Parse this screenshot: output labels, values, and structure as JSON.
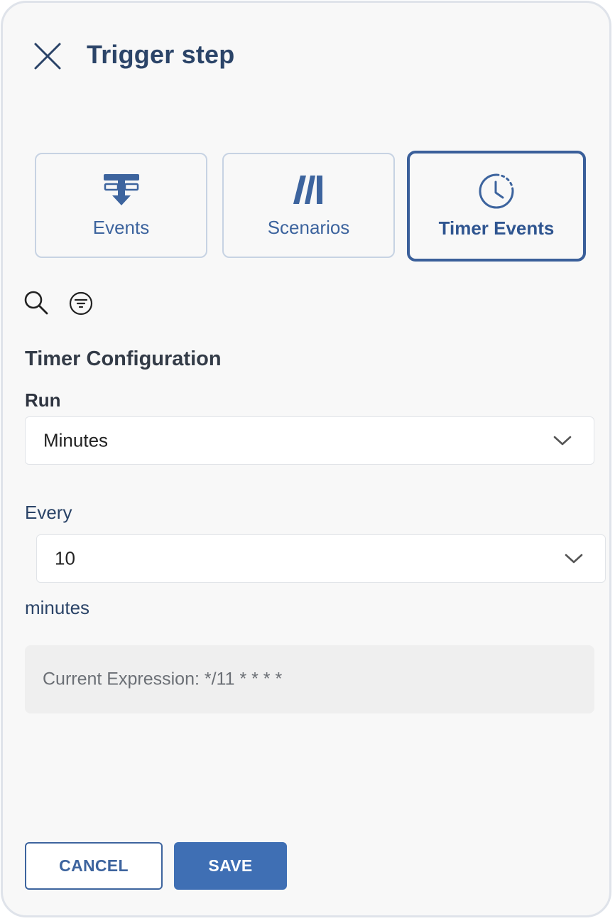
{
  "header": {
    "title": "Trigger step",
    "close_icon": "close-icon"
  },
  "tabs": [
    {
      "label": "Events",
      "icon": "events-icon",
      "active": false
    },
    {
      "label": "Scenarios",
      "icon": "scenarios-icon",
      "active": false
    },
    {
      "label": "Timer Events",
      "icon": "clock-icon",
      "active": true
    }
  ],
  "toolbar": {
    "search_icon": "search-icon",
    "filter_icon": "filter-icon"
  },
  "config": {
    "heading": "Timer Configuration",
    "run_label": "Run",
    "run_value": "Minutes",
    "every_label": "Every",
    "every_value": "10",
    "unit_label": "minutes",
    "expression": "Current Expression: */11 * * * *"
  },
  "footer": {
    "cancel_label": "CANCEL",
    "save_label": "SAVE"
  },
  "colors": {
    "primary": "#3f6fb4",
    "title": "#2b4468",
    "active_border": "#3a5f9a",
    "tab_border": "#c7d3e3",
    "panel_background": "#f8f8f8"
  }
}
